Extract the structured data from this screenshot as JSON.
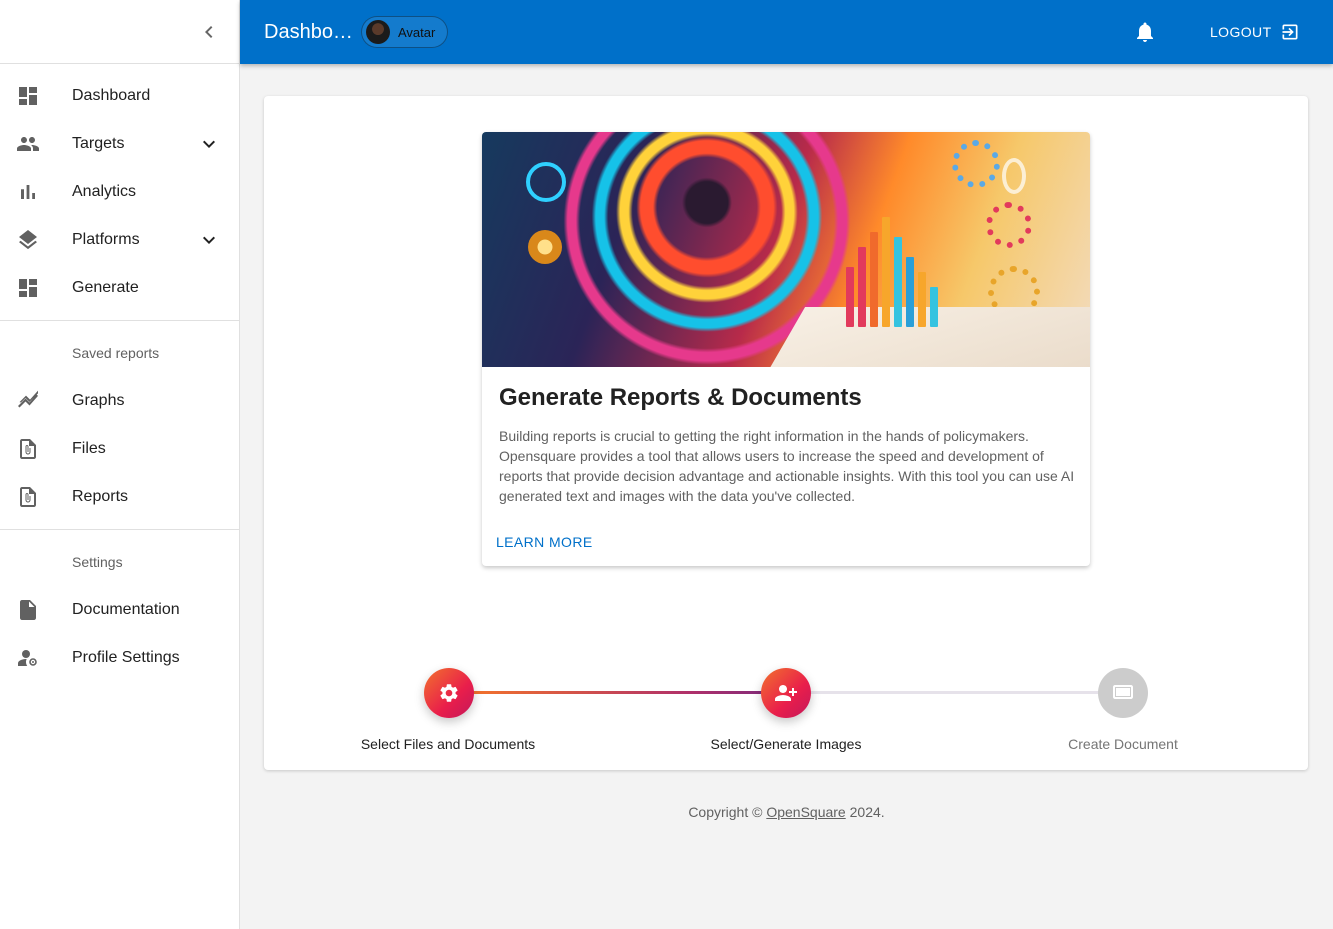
{
  "topbar": {
    "title": "Dashbo…",
    "avatar_label": "Avatar",
    "logout_label": "LOGOUT"
  },
  "sidebar": {
    "main_items": [
      {
        "label": "Dashboard",
        "icon": "dashboard-icon"
      },
      {
        "label": "Targets",
        "icon": "people-icon",
        "expandable": true
      },
      {
        "label": "Analytics",
        "icon": "bar-chart-icon"
      },
      {
        "label": "Platforms",
        "icon": "layers-icon",
        "expandable": true
      },
      {
        "label": "Generate",
        "icon": "dashboard-icon"
      }
    ],
    "saved_reports_header": "Saved reports",
    "saved_items": [
      {
        "label": "Graphs",
        "icon": "trend-icon"
      },
      {
        "label": "Files",
        "icon": "attachment-file-icon"
      },
      {
        "label": "Reports",
        "icon": "attachment-file-icon"
      }
    ],
    "settings_header": "Settings",
    "settings_items": [
      {
        "label": "Documentation",
        "icon": "document-icon"
      },
      {
        "label": "Profile Settings",
        "icon": "manage-account-icon"
      }
    ]
  },
  "feature_card": {
    "title": "Generate Reports & Documents",
    "description": "Building reports is crucial to getting the right information in the hands of policymakers. Opensquare provides a tool that allows users to increase the speed and development of reports that provide decision advantage and actionable insights. With this tool you can use AI generated text and images with the data you've collected.",
    "learn_more": "LEARN MORE"
  },
  "stepper": {
    "steps": [
      {
        "label": "Select Files and Documents",
        "icon": "settings-gear-icon",
        "state": "completed"
      },
      {
        "label": "Select/Generate Images",
        "icon": "add-person-icon",
        "state": "active"
      },
      {
        "label": "Create Document",
        "icon": "monitor-icon",
        "state": "pending"
      }
    ]
  },
  "footer": {
    "prefix": "Copyright © ",
    "link": "OpenSquare",
    "suffix": " 2024."
  },
  "colors": {
    "primary": "#0070c9",
    "step_active_start": "#f2722c",
    "step_active_end": "#c2185b",
    "step_pending": "#cccccc"
  }
}
